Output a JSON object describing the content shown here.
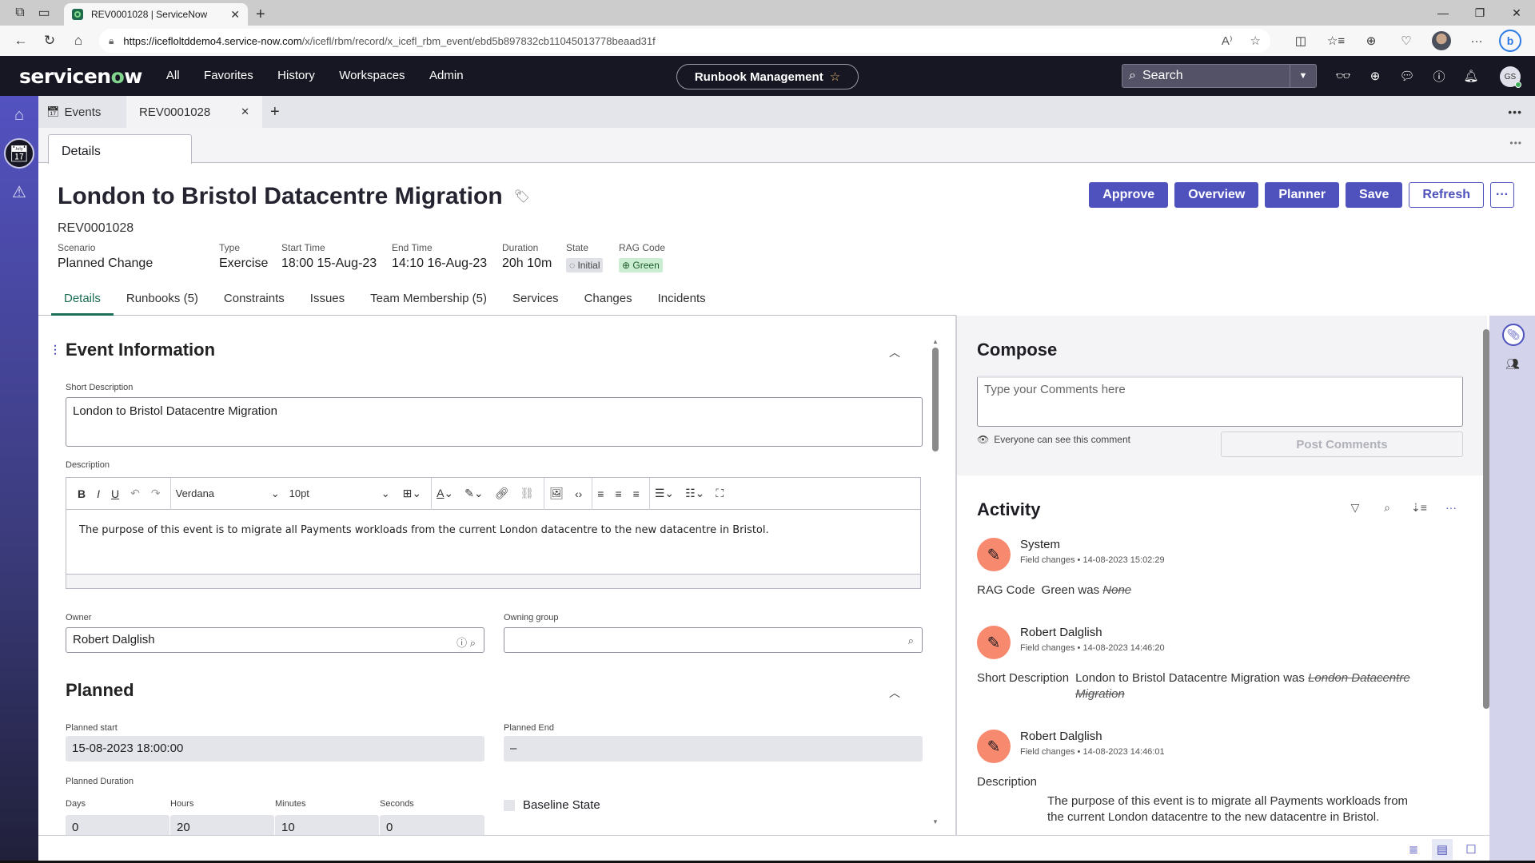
{
  "browser": {
    "tab_title": "REV0001028 | ServiceNow",
    "url_host": "https://icefloltddemo4.service-now.com",
    "url_path": "/x/icefl/rbm/record/x_icefl_rbm_event/ebd5b897832cb11045013778beaad31f"
  },
  "header": {
    "logo_pre": "servicen",
    "logo_o": "o",
    "logo_post": "w",
    "menu": [
      "All",
      "Favorites",
      "History",
      "Workspaces",
      "Admin"
    ],
    "app_name": "Runbook Management",
    "search_placeholder": "Search",
    "user_initials": "GS"
  },
  "workspace_tabs": {
    "events_label": "Events",
    "record_label": "REV0001028"
  },
  "subtab": "Details",
  "record": {
    "title": "London to Bristol Datacentre Migration",
    "number": "REV0001028",
    "summary": [
      {
        "label": "Scenario",
        "value": "Planned Change"
      },
      {
        "label": "Type",
        "value": "Exercise"
      },
      {
        "label": "Start Time",
        "value": "18:00 15-Aug-23"
      },
      {
        "label": "End Time",
        "value": "14:10 16-Aug-23"
      },
      {
        "label": "Duration",
        "value": "20h 10m"
      },
      {
        "label": "State",
        "value": "Initial"
      },
      {
        "label": "RAG Code",
        "value": "Green"
      }
    ],
    "actions": [
      "Approve",
      "Overview",
      "Planner",
      "Save",
      "Refresh"
    ]
  },
  "record_tabs": [
    "Details",
    "Runbooks (5)",
    "Constraints",
    "Issues",
    "Team Membership (5)",
    "Services",
    "Changes",
    "Incidents"
  ],
  "form": {
    "event_info_title": "Event Information",
    "short_desc_label": "Short Description",
    "short_desc_value": "London to Bristol Datacentre Migration",
    "description_label": "Description",
    "rte_font": "Verdana",
    "rte_size": "10pt",
    "description_value": "The purpose of this event is to migrate all Payments workloads from the current London datacentre to the new datacentre in Bristol.",
    "owner_label": "Owner",
    "owner_value": "Robert Dalglish",
    "owning_group_label": "Owning group",
    "owning_group_value": "",
    "planned_title": "Planned",
    "planned_start_label": "Planned start",
    "planned_start_value": "15-08-2023 18:00:00",
    "planned_end_label": "Planned End",
    "planned_end_value": "–",
    "planned_duration_label": "Planned Duration",
    "duration": {
      "days_label": "Days",
      "days": "0",
      "hours_label": "Hours",
      "hours": "20",
      "minutes_label": "Minutes",
      "minutes": "10",
      "seconds_label": "Seconds",
      "seconds": "0"
    },
    "baseline_label": "Baseline State"
  },
  "compose": {
    "title": "Compose",
    "placeholder": "Type your Comments here",
    "visibility": "Everyone can see this comment",
    "post_label": "Post Comments"
  },
  "activity": {
    "title": "Activity",
    "entries": [
      {
        "who": "System",
        "meta": "Field changes • 14-08-2023 15:02:29",
        "field": "RAG Code",
        "new": "Green was",
        "old": "None"
      },
      {
        "who": "Robert Dalglish",
        "meta": "Field changes • 14-08-2023 14:46:20",
        "field": "Short Description",
        "new": "London to Bristol Datacentre Migration was",
        "old": "London Datacentre Migration"
      },
      {
        "who": "Robert Dalglish",
        "meta": "Field changes • 14-08-2023 14:46:01",
        "field": "Description",
        "new": "The purpose of this event is to migrate all Payments workloads from the current London datacentre to the new datacentre in Bristol.",
        "old": ""
      }
    ]
  },
  "colors": {
    "brand_header": "#171723",
    "primary_button": "#4f52bd",
    "active_tab": "#1d6e56",
    "avatar_bg": "#f7896e",
    "rag_green": "#cbeed2"
  }
}
